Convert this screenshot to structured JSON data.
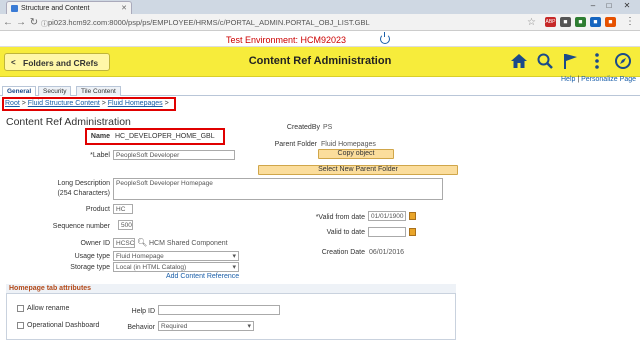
{
  "browser": {
    "tab_title": "Structure and Content",
    "url": "pi023.hcm92.com:8000/psp/ps/EMPLOYEE/HRMS/c/PORTAL_ADMIN.PORTAL_OBJ_LIST.GBL"
  },
  "env": {
    "text": "Test Environment: HCM92023"
  },
  "header": {
    "back_label": "Folders and CRefs",
    "title": "Content Ref Administration",
    "icons": [
      "home-icon",
      "search-icon",
      "flag-icon",
      "more-icon",
      "navbar-icon"
    ]
  },
  "help": {
    "help": "Help",
    "sep": " | ",
    "personalize": "Personalize Page"
  },
  "tabs": [
    "General",
    "Security",
    "Tile Content"
  ],
  "breadcrumb": {
    "root": "Root",
    "fluid_structure": "Fluid Structure Content",
    "fluid_homepages": "Fluid Homepages",
    "sep": ">"
  },
  "section_title": "Content Ref Administration",
  "form": {
    "name_label": "Name",
    "name_value": "HC_DEVELOPER_HOME_GBL",
    "label_label": "*Label",
    "label_value": "PeopleSoft Developer",
    "createdby_label": "CreatedBy",
    "createdby_value": "PS",
    "parent_label": "Parent Folder",
    "parent_value": "Fluid Homepages",
    "copy_button": "Copy object",
    "select_parent_button": "Select New Parent Folder",
    "long_desc_label": "Long Description",
    "long_desc_sub": "(254 Characters)",
    "long_desc_value": "PeopleSoft Developer Homepage",
    "product_label": "Product",
    "product_value": "HC",
    "seq_label": "Sequence number",
    "seq_value": "500",
    "valid_from_label": "*Valid from date",
    "valid_from_value": "01/01/1900",
    "valid_to_label": "Valid to date",
    "valid_to_value": "",
    "owner_label": "Owner ID",
    "owner_value": "HCSC",
    "owner_desc": "HCM Shared Component",
    "usage_label": "Usage type",
    "usage_value": "Fluid Homepage",
    "storage_label": "Storage type",
    "storage_value": "Local (in HTML Catalog)",
    "creation_label": "Creation Date",
    "creation_value": "06/01/2016",
    "add_ref_link": "Add Content Reference"
  },
  "homepage_attrs": {
    "title": "Homepage tab attributes",
    "allow_rename": "Allow rename",
    "operational_dashboard": "Operational Dashboard",
    "help_id_label": "Help ID",
    "behavior_label": "Behavior",
    "behavior_value": "Required"
  },
  "colors": {
    "header_yellow": "#f7ec3b",
    "env_red": "#cc0000",
    "link_blue": "#1a5ea8",
    "highlight_red": "#e00000"
  }
}
